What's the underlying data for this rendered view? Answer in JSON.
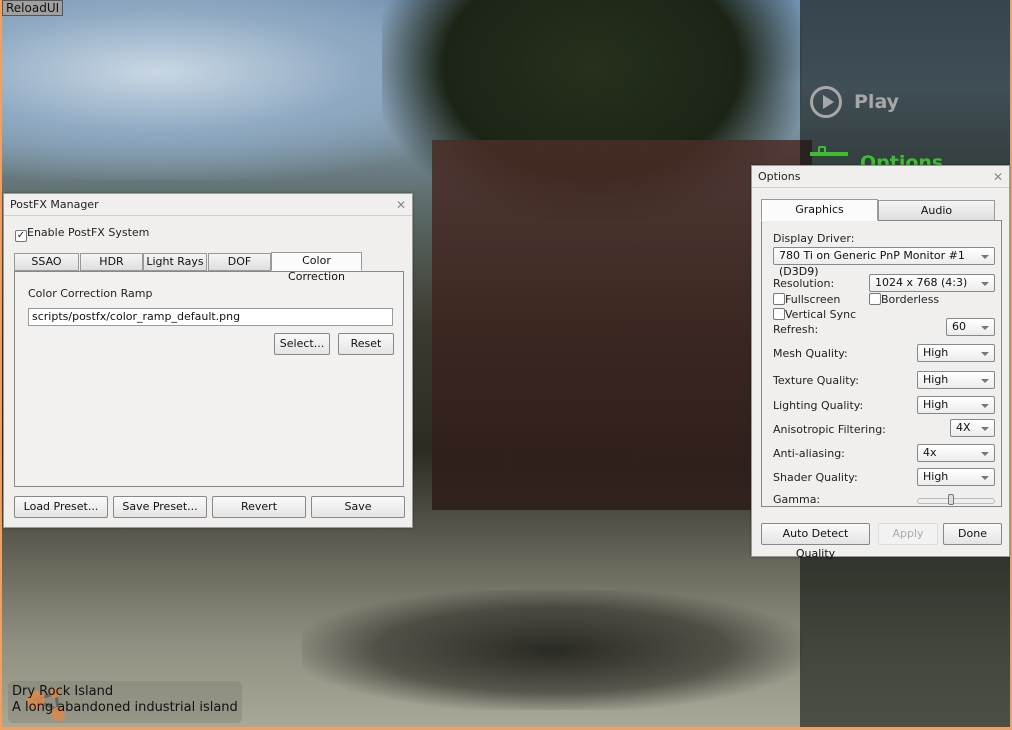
{
  "reload_button": "ReloadUI",
  "main_menu": {
    "items": [
      {
        "label": "Play"
      },
      {
        "label": "Options"
      }
    ],
    "accent": "#3bbf2f"
  },
  "postfx": {
    "title": "PostFX Manager",
    "enable_label": "Enable PostFX System",
    "enabled": true,
    "tabs": [
      "SSAO",
      "HDR",
      "Light Rays",
      "DOF",
      "Color Correction"
    ],
    "active_tab": "Color Correction",
    "ramp_label": "Color Correction Ramp",
    "ramp_value": "scripts/postfx/color_ramp_default.png",
    "select_button": "Select...",
    "reset_button": "Reset",
    "footer": [
      "Load Preset...",
      "Save Preset...",
      "Revert",
      "Save"
    ]
  },
  "options": {
    "title": "Options",
    "tabs": [
      "Graphics",
      "Audio"
    ],
    "active_tab": "Graphics",
    "display_driver_label": "Display Driver:",
    "display_driver_value": "780 Ti on Generic PnP Monitor #1 (D3D9)",
    "resolution_label": "Resolution:",
    "resolution_value": "1024 x 768  (4:3)",
    "fullscreen": "Fullscreen",
    "borderless": "Borderless",
    "vsync": "Vertical Sync",
    "refresh_label": "Refresh:",
    "refresh_value": "60",
    "mesh_label": "Mesh Quality:",
    "mesh_value": "High",
    "texture_label": "Texture Quality:",
    "texture_value": "High",
    "lighting_label": "Lighting Quality:",
    "lighting_value": "High",
    "aniso_label": "Anisotropic Filtering:",
    "aniso_value": "4X",
    "aa_label": "Anti-aliasing:",
    "aa_value": "4x",
    "shader_label": "Shader Quality:",
    "shader_value": "High",
    "gamma_label": "Gamma:",
    "gamma_fraction": 0.43,
    "auto_detect": "Auto Detect Quality",
    "apply": "Apply",
    "done": "Done"
  },
  "level": {
    "name": "Dry Rock Island",
    "description": "A long abandoned industrial island"
  }
}
